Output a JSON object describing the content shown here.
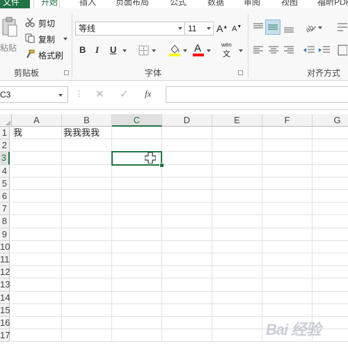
{
  "ribbon": {
    "tabs": [
      "文件",
      "开始",
      "插入",
      "页面布局",
      "公式",
      "数据",
      "审阅",
      "视图",
      "福昕PDF"
    ],
    "active_tab": "开始",
    "clipboard": {
      "paste": "粘贴",
      "cut": "剪切",
      "copy": "复制",
      "format_painter": "格式刷",
      "group_label": "剪贴板"
    },
    "font": {
      "font_name": "等线",
      "font_size": "11",
      "bold": "B",
      "italic": "I",
      "underline": "U",
      "phonetic": "wén",
      "group_label": "字体"
    },
    "alignment": {
      "group_label": "对齐方式"
    },
    "colors": {
      "accent": "#217346",
      "highlight": "#ffff00",
      "font_color": "#ff0000"
    }
  },
  "formula_bar": {
    "name_box": "C3",
    "fx_label": "fx",
    "formula": ""
  },
  "sheet": {
    "columns": [
      "A",
      "B",
      "C",
      "D",
      "E",
      "F",
      "G"
    ],
    "rows": [
      "1",
      "2",
      "3",
      "4",
      "5",
      "6",
      "7",
      "8",
      "9",
      "10",
      "11",
      "12",
      "13",
      "14",
      "15",
      "16",
      "17"
    ],
    "selected_cell": "C3",
    "cells": {
      "A1": "我",
      "B1": "我我我我"
    }
  },
  "watermark": {
    "text": "Bai 经验"
  }
}
